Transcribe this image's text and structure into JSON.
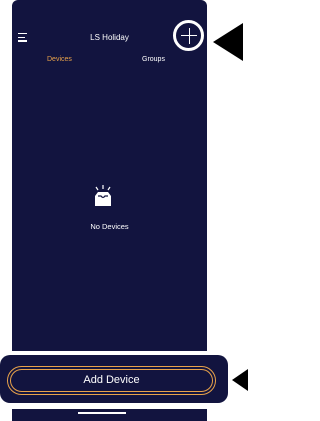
{
  "app": {
    "title": "LS Holiday"
  },
  "tabs": [
    {
      "label": "Devices",
      "active": true
    },
    {
      "label": "Groups",
      "active": false
    }
  ],
  "empty_state": {
    "text": "No Devices",
    "icon": "empty-tray-icon"
  },
  "actions": {
    "add_device_label": "Add Device"
  },
  "colors": {
    "background": "#12143f",
    "accent": "#e8a24a",
    "text": "#ffffff",
    "arrow": "#000000"
  }
}
